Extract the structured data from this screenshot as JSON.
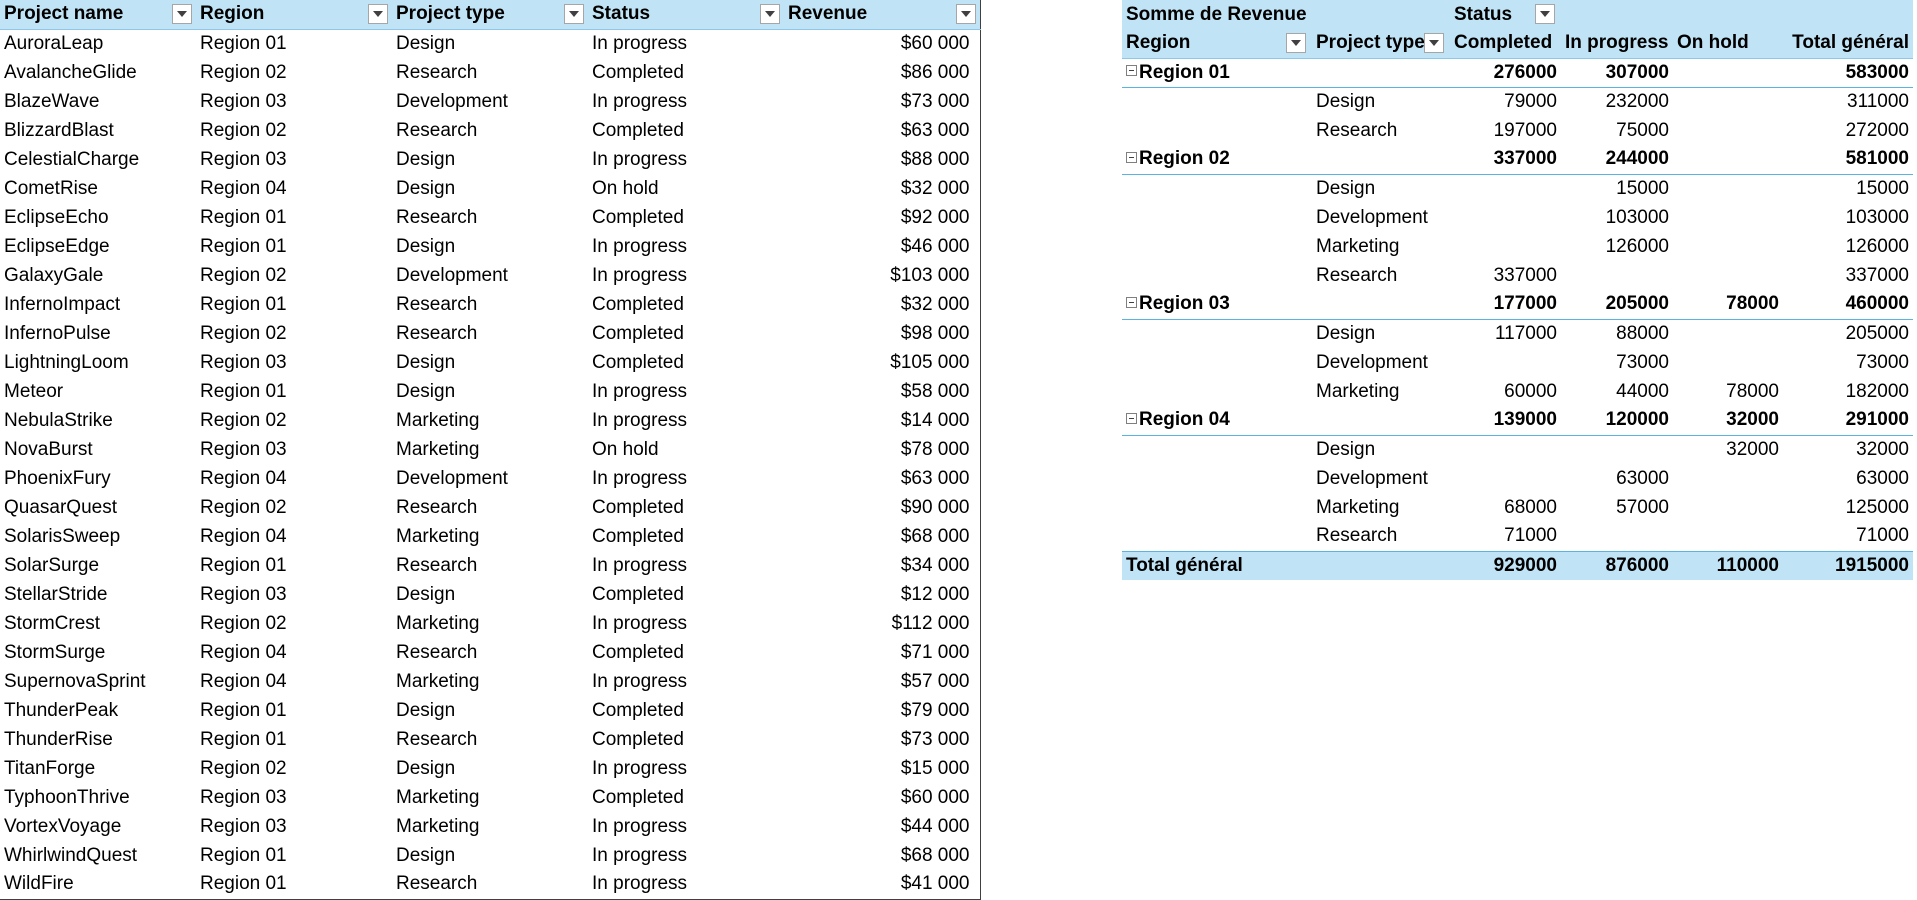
{
  "source_table": {
    "headers": [
      "Project name",
      "Region",
      "Project type",
      "Status",
      "Revenue"
    ],
    "rows": [
      [
        "AuroraLeap",
        "Region 01",
        "Design",
        "In progress",
        "$60 000"
      ],
      [
        "AvalancheGlide",
        "Region 02",
        "Research",
        "Completed",
        "$86 000"
      ],
      [
        "BlazeWave",
        "Region 03",
        "Development",
        "In progress",
        "$73 000"
      ],
      [
        "BlizzardBlast",
        "Region 02",
        "Research",
        "Completed",
        "$63 000"
      ],
      [
        "CelestialCharge",
        "Region 03",
        "Design",
        "In progress",
        "$88 000"
      ],
      [
        "CometRise",
        "Region 04",
        "Design",
        "On hold",
        "$32 000"
      ],
      [
        "EclipseEcho",
        "Region 01",
        "Research",
        "Completed",
        "$92 000"
      ],
      [
        "EclipseEdge",
        "Region 01",
        "Design",
        "In progress",
        "$46 000"
      ],
      [
        "GalaxyGale",
        "Region 02",
        "Development",
        "In progress",
        "$103 000"
      ],
      [
        "InfernoImpact",
        "Region 01",
        "Research",
        "Completed",
        "$32 000"
      ],
      [
        "InfernoPulse",
        "Region 02",
        "Research",
        "Completed",
        "$98 000"
      ],
      [
        "LightningLoom",
        "Region 03",
        "Design",
        "Completed",
        "$105 000"
      ],
      [
        "Meteor",
        "Region 01",
        "Design",
        "In progress",
        "$58 000"
      ],
      [
        "NebulaStrike",
        "Region 02",
        "Marketing",
        "In progress",
        "$14 000"
      ],
      [
        "NovaBurst",
        "Region 03",
        "Marketing",
        "On hold",
        "$78 000"
      ],
      [
        "PhoenixFury",
        "Region 04",
        "Development",
        "In progress",
        "$63 000"
      ],
      [
        "QuasarQuest",
        "Region 02",
        "Research",
        "Completed",
        "$90 000"
      ],
      [
        "SolarisSweep",
        "Region 04",
        "Marketing",
        "Completed",
        "$68 000"
      ],
      [
        "SolarSurge",
        "Region 01",
        "Research",
        "In progress",
        "$34 000"
      ],
      [
        "StellarStride",
        "Region 03",
        "Design",
        "Completed",
        "$12 000"
      ],
      [
        "StormCrest",
        "Region 02",
        "Marketing",
        "In progress",
        "$112 000"
      ],
      [
        "StormSurge",
        "Region 04",
        "Research",
        "Completed",
        "$71 000"
      ],
      [
        "SupernovaSprint",
        "Region 04",
        "Marketing",
        "In progress",
        "$57 000"
      ],
      [
        "ThunderPeak",
        "Region 01",
        "Design",
        "Completed",
        "$79 000"
      ],
      [
        "ThunderRise",
        "Region 01",
        "Research",
        "Completed",
        "$73 000"
      ],
      [
        "TitanForge",
        "Region 02",
        "Design",
        "In progress",
        "$15 000"
      ],
      [
        "TyphoonThrive",
        "Region 03",
        "Marketing",
        "Completed",
        "$60 000"
      ],
      [
        "VortexVoyage",
        "Region 03",
        "Marketing",
        "In progress",
        "$44 000"
      ],
      [
        "WhirlwindQuest",
        "Region 01",
        "Design",
        "In progress",
        "$68 000"
      ],
      [
        "WildFire",
        "Region 01",
        "Research",
        "In progress",
        "$41 000"
      ]
    ]
  },
  "pivot": {
    "value_label": "Somme de Revenue",
    "column_field": "Status",
    "row_field_1": "Region",
    "row_field_2": "Project type",
    "status_columns": [
      "Completed",
      "In progress",
      "On hold"
    ],
    "grand_total_label": "Total général",
    "groups": [
      {
        "region": "Region 01",
        "totals": [
          "276000",
          "307000",
          "",
          "583000"
        ],
        "types": [
          {
            "name": "Design",
            "values": [
              "79000",
              "232000",
              "",
              "311000"
            ]
          },
          {
            "name": "Research",
            "values": [
              "197000",
              "75000",
              "",
              "272000"
            ]
          }
        ]
      },
      {
        "region": "Region 02",
        "totals": [
          "337000",
          "244000",
          "",
          "581000"
        ],
        "types": [
          {
            "name": "Design",
            "values": [
              "",
              "15000",
              "",
              "15000"
            ]
          },
          {
            "name": "Development",
            "values": [
              "",
              "103000",
              "",
              "103000"
            ]
          },
          {
            "name": "Marketing",
            "values": [
              "",
              "126000",
              "",
              "126000"
            ]
          },
          {
            "name": "Research",
            "values": [
              "337000",
              "",
              "",
              "337000"
            ]
          }
        ]
      },
      {
        "region": "Region 03",
        "totals": [
          "177000",
          "205000",
          "78000",
          "460000"
        ],
        "types": [
          {
            "name": "Design",
            "values": [
              "117000",
              "88000",
              "",
              "205000"
            ]
          },
          {
            "name": "Development",
            "values": [
              "",
              "73000",
              "",
              "73000"
            ]
          },
          {
            "name": "Marketing",
            "values": [
              "60000",
              "44000",
              "78000",
              "182000"
            ]
          }
        ]
      },
      {
        "region": "Region 04",
        "totals": [
          "139000",
          "120000",
          "32000",
          "291000"
        ],
        "types": [
          {
            "name": "Design",
            "values": [
              "",
              "",
              "32000",
              "32000"
            ]
          },
          {
            "name": "Development",
            "values": [
              "",
              "63000",
              "",
              "63000"
            ]
          },
          {
            "name": "Marketing",
            "values": [
              "68000",
              "57000",
              "",
              "125000"
            ]
          },
          {
            "name": "Research",
            "values": [
              "71000",
              "",
              "",
              "71000"
            ]
          }
        ]
      }
    ],
    "grand_totals": [
      "929000",
      "876000",
      "110000",
      "1915000"
    ]
  }
}
